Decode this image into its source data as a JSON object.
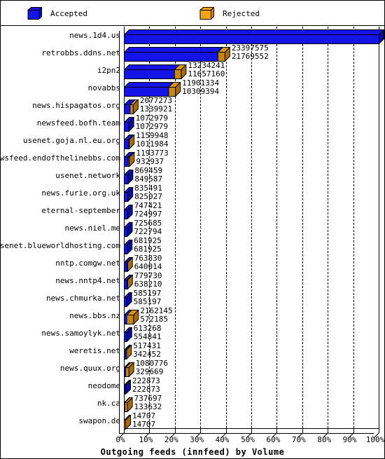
{
  "legend": {
    "accepted": {
      "label": "Accepted",
      "color": "#1414e6",
      "icon": "cube-icon"
    },
    "rejected": {
      "label": "Rejected",
      "color": "#f0a415",
      "icon": "cube-icon"
    }
  },
  "chart_data": {
    "type": "bar",
    "orientation": "horizontal",
    "stacked": true,
    "title": "Outgoing feeds (innfeed) by Volume",
    "xlabel": "",
    "ylabel": "",
    "xlim": [
      0,
      100
    ],
    "x_tick_labels": [
      "0%",
      "10%",
      "20%",
      "30%",
      "40%",
      "50%",
      "60%",
      "70%",
      "80%",
      "90%",
      "100%"
    ],
    "x_tick_values": [
      0,
      10,
      20,
      30,
      40,
      50,
      60,
      70,
      80,
      90,
      100
    ],
    "grid": true,
    "grid_style": "dashed-vertical",
    "legend_position": "top",
    "max_value": 59218958,
    "series": [
      {
        "name": "Accepted",
        "color": "#1414e6"
      },
      {
        "name": "Rejected",
        "color": "#c8860a"
      }
    ],
    "categories": [
      "news.1d4.us",
      "retrobbs.ddns.net",
      "i2pn2",
      "novabbs",
      "news.hispagatos.org",
      "newsfeed.bofh.team",
      "usenet.goja.nl.eu.org",
      "newsfeed.endofthelinebbs.com",
      "usenet.network",
      "news.furie.org.uk",
      "eternal-september",
      "news.niel.me",
      "usenet.blueworldhosting.com",
      "nntp.comgw.net",
      "news.nntp4.net",
      "news.chmurka.net",
      "news.bbs.nz",
      "news.samoylyk.net",
      "weretis.net",
      "news.quux.org",
      "neodome",
      "nk.ca",
      "swapon.de"
    ],
    "rows": [
      {
        "label": "news.1d4.us",
        "total": 59218958,
        "accepted": 59190705
      },
      {
        "label": "retrobbs.ddns.net",
        "total": 23397575,
        "accepted": 21769552
      },
      {
        "label": "i2pn2",
        "total": 13234241,
        "accepted": 11657160
      },
      {
        "label": "novabbs",
        "total": 11901334,
        "accepted": 10309394
      },
      {
        "label": "news.hispagatos.org",
        "total": 2077273,
        "accepted": 1339921
      },
      {
        "label": "newsfeed.bofh.team",
        "total": 1072979,
        "accepted": 1072979
      },
      {
        "label": "usenet.goja.nl.eu.org",
        "total": 1159948,
        "accepted": 1011984
      },
      {
        "label": "newsfeed.endofthelinebbs.com",
        "total": 1193773,
        "accepted": 932937
      },
      {
        "label": "usenet.network",
        "total": 869459,
        "accepted": 849587
      },
      {
        "label": "news.furie.org.uk",
        "total": 835491,
        "accepted": 825027
      },
      {
        "label": "eternal-september",
        "total": 747421,
        "accepted": 724997
      },
      {
        "label": "news.niel.me",
        "total": 725685,
        "accepted": 722794
      },
      {
        "label": "usenet.blueworldhosting.com",
        "total": 681925,
        "accepted": 681925
      },
      {
        "label": "nntp.comgw.net",
        "total": 763830,
        "accepted": 640014
      },
      {
        "label": "news.nntp4.net",
        "total": 779730,
        "accepted": 638210
      },
      {
        "label": "news.chmurka.net",
        "total": 585197,
        "accepted": 585197
      },
      {
        "label": "news.bbs.nz",
        "total": 2162145,
        "accepted": 572185
      },
      {
        "label": "news.samoylyk.net",
        "total": 613268,
        "accepted": 554841
      },
      {
        "label": "weretis.net",
        "total": 517431,
        "accepted": 342452
      },
      {
        "label": "news.quux.org",
        "total": 1080776,
        "accepted": 329669
      },
      {
        "label": "neodome",
        "total": 222873,
        "accepted": 222873
      },
      {
        "label": "nk.ca",
        "total": 737697,
        "accepted": 133632
      },
      {
        "label": "swapon.de",
        "total": 14707,
        "accepted": 14707
      }
    ]
  }
}
